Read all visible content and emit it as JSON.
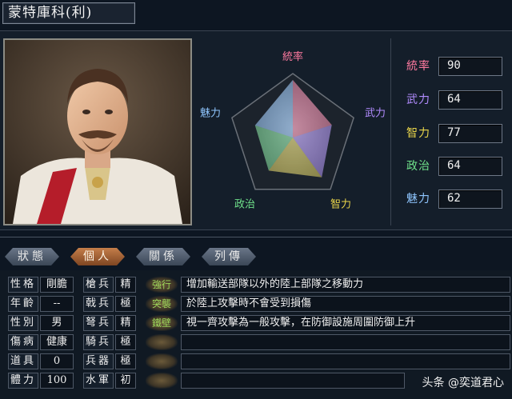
{
  "title": "蒙特庫科(利)",
  "radar": {
    "labels": {
      "tong": "統率",
      "wu": "武力",
      "zhi": "智力",
      "zheng": "政治",
      "mei": "魅力"
    },
    "colors": {
      "tong": "#ff7aa0",
      "wu": "#b28cff",
      "zhi": "#e8d44a",
      "zheng": "#6fe08a",
      "mei": "#8fc6ff"
    },
    "values": {
      "tong": 90,
      "wu": 64,
      "zhi": 77,
      "zheng": 64,
      "mei": 62
    },
    "max": 100
  },
  "stats": [
    {
      "label": "統率",
      "value": "90",
      "color": "#ff7aa0"
    },
    {
      "label": "武力",
      "value": "64",
      "color": "#b28cff"
    },
    {
      "label": "智力",
      "value": "77",
      "color": "#e8d44a"
    },
    {
      "label": "政治",
      "value": "64",
      "color": "#6fe08a"
    },
    {
      "label": "魅力",
      "value": "62",
      "color": "#8fc6ff"
    }
  ],
  "tabs": [
    "狀態",
    "個人",
    "關係",
    "列傳"
  ],
  "active_tab": 1,
  "personal": [
    {
      "label": "性格",
      "value": "剛膽"
    },
    {
      "label": "年齡",
      "value": "--"
    },
    {
      "label": "性別",
      "value": "男"
    },
    {
      "label": "傷病",
      "value": "健康"
    },
    {
      "label": "道具",
      "value": "0"
    },
    {
      "label": "體力",
      "value": "100"
    }
  ],
  "aptitude": [
    {
      "label": "槍兵",
      "value": "精"
    },
    {
      "label": "戟兵",
      "value": "極"
    },
    {
      "label": "弩兵",
      "value": "精"
    },
    {
      "label": "騎兵",
      "value": "極"
    },
    {
      "label": "兵器",
      "value": "極"
    },
    {
      "label": "水軍",
      "value": "初"
    }
  ],
  "skills": [
    {
      "name": "強行",
      "desc": "增加輸送部隊以外的陸上部隊之移動力"
    },
    {
      "name": "突襲",
      "desc": "於陸上攻擊時不會受到損傷"
    },
    {
      "name": "鐵壁",
      "desc": "視一齊攻擊為一般攻擊，在防御設施周圍防御上升"
    },
    {
      "name": "",
      "desc": ""
    },
    {
      "name": "",
      "desc": ""
    },
    {
      "name": "",
      "desc": ""
    }
  ],
  "watermark": "头条 @奕道君心"
}
